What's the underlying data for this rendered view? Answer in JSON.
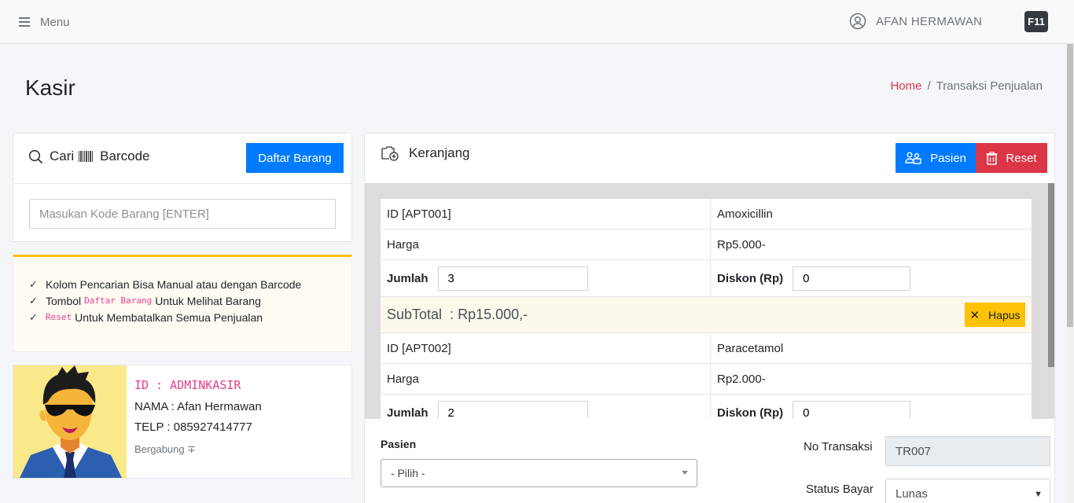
{
  "topbar": {
    "menu_label": "Menu",
    "user_name": "AFAN HERMAWAN",
    "fullscreen_key": "F11"
  },
  "page": {
    "title": "Kasir"
  },
  "breadcrumb": {
    "home": "Home",
    "separator": "/",
    "current": "Transaksi Penjualan"
  },
  "search": {
    "title_prefix": "Cari",
    "title_suffix": "Barcode",
    "daftar_button": "Daftar Barang",
    "input_placeholder": "Masukan Kode Barang [ENTER]",
    "input_value": ""
  },
  "info": {
    "items": [
      {
        "before": "Kolom Pencarian Bisa Manual atau dengan Barcode",
        "code": "",
        "after": ""
      },
      {
        "before": "Tombol",
        "code": "Daftar Barang",
        "after": "Untuk Melihat Barang"
      },
      {
        "before": "",
        "code": "Reset",
        "after": "Untuk Membatalkan Semua Penjualan"
      }
    ]
  },
  "profile": {
    "id": "ID : ADMINKASIR",
    "nama": "NAMA : Afan Hermawan",
    "telp": "TELP : 085927414777",
    "bergabung": "Bergabung ∓"
  },
  "cart": {
    "title": "Keranjang",
    "pasien_button": "Pasien",
    "reset_button": "Reset",
    "harga_label": "Harga",
    "jumlah_label": "Jumlah",
    "diskon_label": "Diskon (Rp)",
    "subtotal_label": "SubTotal",
    "hapus_button": "Hapus",
    "items": [
      {
        "id": "ID [APT001]",
        "name": "Amoxicillin",
        "harga": "Rp5.000-",
        "jumlah": "3",
        "diskon": "0",
        "subtotal": ": Rp15.000,-"
      },
      {
        "id": "ID [APT002]",
        "name": "Paracetamol",
        "harga": "Rp2.000-",
        "jumlah": "2",
        "diskon": "0"
      }
    ]
  },
  "form": {
    "pasien_label": "Pasien",
    "pasien_selected": "- Pilih -",
    "no_transaksi_label": "No Transaksi",
    "no_transaksi_value": "TR007",
    "status_bayar_label": "Status Bayar",
    "status_bayar_value": "Lunas"
  },
  "colors": {
    "primary": "#007bff",
    "danger": "#dc3545",
    "warning": "#ffc107",
    "code_pink": "#e83e8c"
  }
}
